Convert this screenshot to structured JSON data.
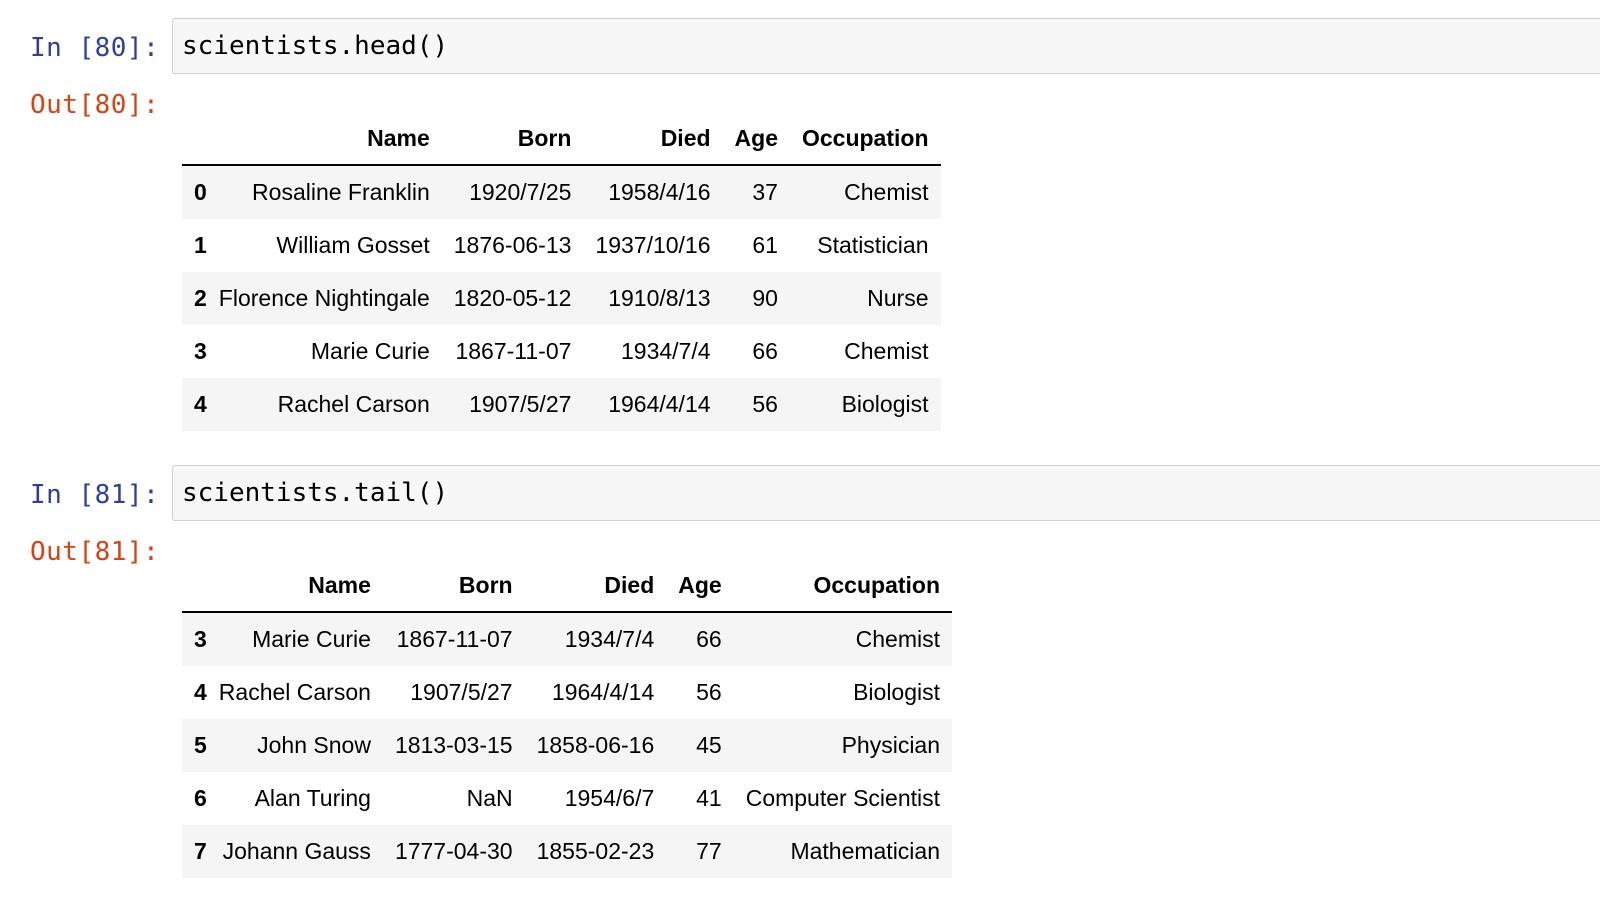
{
  "cells": [
    {
      "in_prompt": "In [80]:",
      "code": "scientists.head()",
      "out_prompt": "Out[80]:",
      "columns": [
        "",
        "Name",
        "Born",
        "Died",
        "Age",
        "Occupation"
      ],
      "rows": [
        {
          "index": "0",
          "name": "Rosaline Franklin",
          "born": "1920/7/25",
          "died": "1958/4/16",
          "age": "37",
          "occupation": "Chemist"
        },
        {
          "index": "1",
          "name": "William Gosset",
          "born": "1876-06-13",
          "died": "1937/10/16",
          "age": "61",
          "occupation": "Statistician"
        },
        {
          "index": "2",
          "name": "Florence Nightingale",
          "born": "1820-05-12",
          "died": "1910/8/13",
          "age": "90",
          "occupation": "Nurse"
        },
        {
          "index": "3",
          "name": "Marie Curie",
          "born": "1867-11-07",
          "died": "1934/7/4",
          "age": "66",
          "occupation": "Chemist"
        },
        {
          "index": "4",
          "name": "Rachel Carson",
          "born": "1907/5/27",
          "died": "1964/4/14",
          "age": "56",
          "occupation": "Biologist"
        }
      ]
    },
    {
      "in_prompt": "In [81]:",
      "code": "scientists.tail()",
      "out_prompt": "Out[81]:",
      "columns": [
        "",
        "Name",
        "Born",
        "Died",
        "Age",
        "Occupation"
      ],
      "rows": [
        {
          "index": "3",
          "name": "Marie Curie",
          "born": "1867-11-07",
          "died": "1934/7/4",
          "age": "66",
          "occupation": "Chemist"
        },
        {
          "index": "4",
          "name": "Rachel Carson",
          "born": "1907/5/27",
          "died": "1964/4/14",
          "age": "56",
          "occupation": "Biologist"
        },
        {
          "index": "5",
          "name": "John Snow",
          "born": "1813-03-15",
          "died": "1858-06-16",
          "age": "45",
          "occupation": "Physician"
        },
        {
          "index": "6",
          "name": "Alan Turing",
          "born": "NaN",
          "died": "1954/6/7",
          "age": "41",
          "occupation": "Computer Scientist"
        },
        {
          "index": "7",
          "name": "Johann Gauss",
          "born": "1777-04-30",
          "died": "1855-02-23",
          "age": "77",
          "occupation": "Mathematician"
        }
      ]
    }
  ]
}
